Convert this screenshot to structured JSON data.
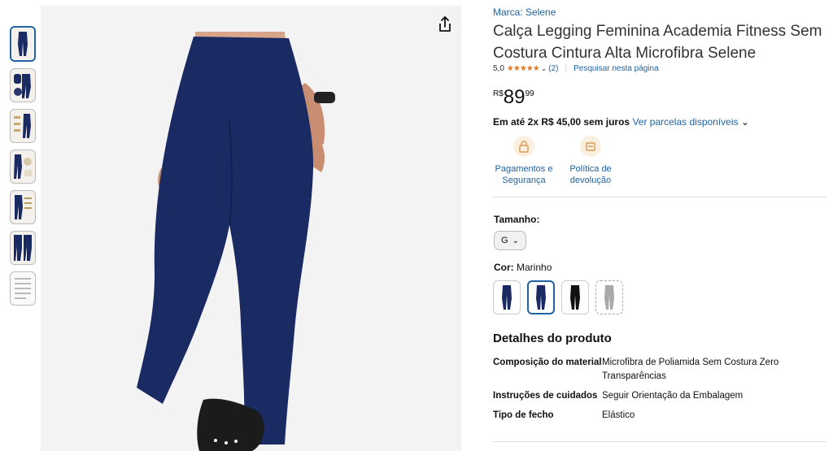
{
  "thumbnails": [
    {
      "name": "thumb-1",
      "selected": true
    },
    {
      "name": "thumb-2",
      "selected": false
    },
    {
      "name": "thumb-3",
      "selected": false
    },
    {
      "name": "thumb-4",
      "selected": false
    },
    {
      "name": "thumb-5",
      "selected": false
    },
    {
      "name": "thumb-6",
      "selected": false
    },
    {
      "name": "thumb-7",
      "selected": false
    }
  ],
  "product": {
    "brand": "Marca: Selene",
    "title": "Calça Legging Feminina Academia Fitness Sem Costura Cintura Alta Microfibra Selene",
    "rating_value": "5,0",
    "stars": "★★★★★",
    "review_count": "(2)",
    "search_page": "Pesquisar nesta página",
    "price": {
      "currency": "R$",
      "whole": "89",
      "fraction": "99"
    },
    "installments": "Em até 2x R$ 45,00 sem juros",
    "installments_link": "Ver parcelas disponíveis"
  },
  "features": [
    {
      "label": "Pagamentos e Segurança",
      "icon": "lock-icon"
    },
    {
      "label": "Política de devolução",
      "icon": "return-icon"
    }
  ],
  "size": {
    "label": "Tamanho:",
    "value": "G"
  },
  "color": {
    "label": "Cor:",
    "value": "Marinho",
    "swatches": [
      {
        "name": "navy-1"
      },
      {
        "name": "navy-2"
      },
      {
        "name": "black"
      },
      {
        "name": "gray"
      }
    ]
  },
  "details": {
    "heading": "Detalhes do produto",
    "rows": [
      {
        "k": "Composição do material",
        "v": "Microfibra de Poliamida Sem Costura Zero Transparências"
      },
      {
        "k": "Instruções de cuidados",
        "v": "Seguir Orientação da Embalagem"
      },
      {
        "k": "Tipo de fecho",
        "v": "Elástico"
      }
    ]
  },
  "colors": {
    "link": "#2162a1",
    "star": "#de7921",
    "legging": "#1a2a63"
  }
}
